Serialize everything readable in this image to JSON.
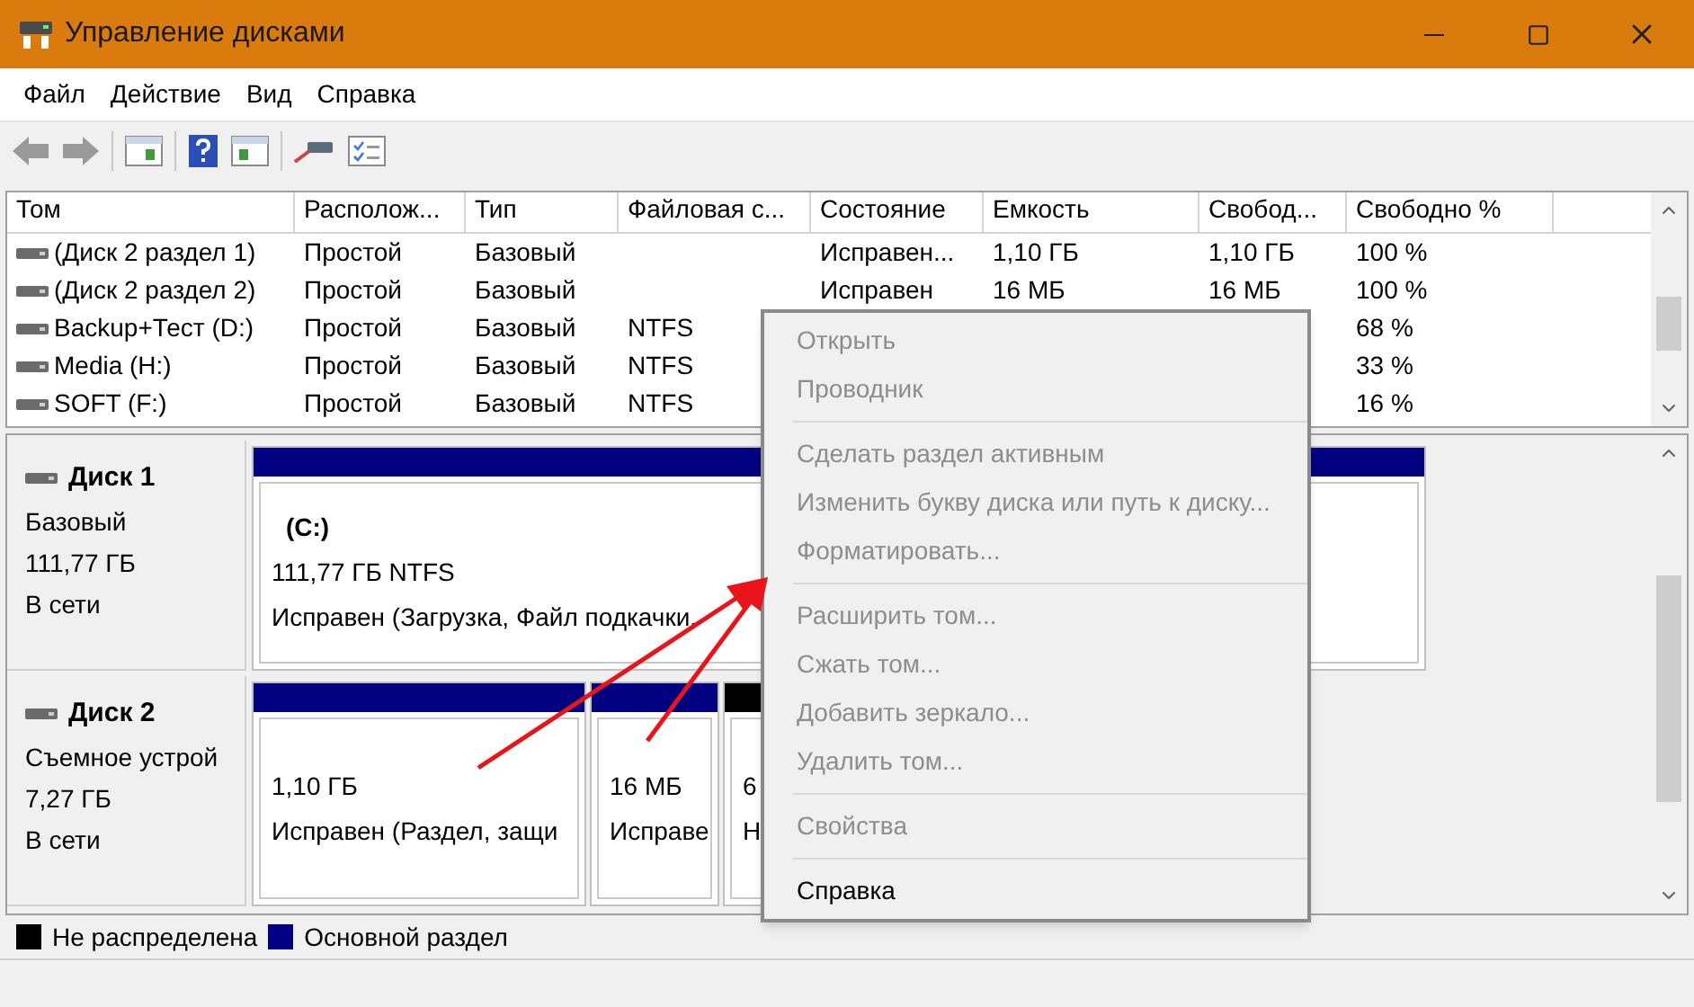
{
  "window": {
    "title": "Управление дисками"
  },
  "menu_bar": [
    "Файл",
    "Действие",
    "Вид",
    "Справка"
  ],
  "table": {
    "columns": [
      "Том",
      "Располож...",
      "Тип",
      "Файловая с...",
      "Состояние",
      "Емкость",
      "Свобод...",
      "Свободно %"
    ],
    "rows": [
      {
        "cells": [
          "(Диск 2 раздел 1)",
          "Простой",
          "Базовый",
          null,
          "Исправен...",
          "1,10 ГБ",
          "1,10 ГБ",
          "100 %"
        ]
      },
      {
        "cells": [
          "(Диск 2 раздел 2)",
          "Простой",
          "Базовый",
          null,
          "Исправен",
          "16 МБ",
          "16 МБ",
          "100 %"
        ]
      },
      {
        "cells": [
          "Backup+Тест (D:)",
          "Простой",
          "Базовый",
          "NTFS",
          null,
          null,
          null,
          "68 %"
        ]
      },
      {
        "cells": [
          "Media (H:)",
          "Простой",
          "Базовый",
          "NTFS",
          null,
          null,
          null,
          "33 %"
        ]
      },
      {
        "cells": [
          "SOFT (F:)",
          "Простой",
          "Базовый",
          "NTFS",
          null,
          null,
          null,
          "16 %"
        ]
      }
    ]
  },
  "disks": [
    {
      "name": "Диск 1",
      "type": "Базовый",
      "size": "111,77 ГБ",
      "status": "В сети",
      "partitions": [
        {
          "kind": "primary",
          "label": "(C:)",
          "size": "111,77 ГБ NTFS",
          "status": "Исправен (Загрузка, Файл подкачки,"
        }
      ]
    },
    {
      "name": "Диск 2",
      "type": "Съемное устрой",
      "size": "7,27 ГБ",
      "status": "В сети",
      "partitions": [
        {
          "kind": "primary",
          "size": "1,10 ГБ",
          "status": "Исправен (Раздел, защи"
        },
        {
          "kind": "primary",
          "size": "16 МБ",
          "status": "Исправе"
        },
        {
          "kind": "unallocated",
          "size": "6",
          "status": "Н"
        }
      ]
    }
  ],
  "legend": [
    {
      "label": "Не распределена",
      "color": "#000000"
    },
    {
      "label": "Основной раздел",
      "color": "#000080"
    }
  ],
  "context_menu": [
    {
      "kind": "item",
      "label": "Открыть",
      "disabled": true
    },
    {
      "kind": "item",
      "label": "Проводник",
      "disabled": true
    },
    {
      "kind": "separator"
    },
    {
      "kind": "item",
      "label": "Сделать раздел активным",
      "disabled": true
    },
    {
      "kind": "item",
      "label": "Изменить букву диска или путь к диску...",
      "disabled": true
    },
    {
      "kind": "item",
      "label": "Форматировать...",
      "disabled": true
    },
    {
      "kind": "separator"
    },
    {
      "kind": "item",
      "label": "Расширить том...",
      "disabled": true
    },
    {
      "kind": "item",
      "label": "Сжать том...",
      "disabled": true
    },
    {
      "kind": "item",
      "label": "Добавить зеркало...",
      "disabled": true
    },
    {
      "kind": "item",
      "label": "Удалить том...",
      "disabled": true
    },
    {
      "kind": "separator"
    },
    {
      "kind": "item",
      "label": "Свойства",
      "disabled": true
    },
    {
      "kind": "separator"
    },
    {
      "kind": "item",
      "label": "Справка",
      "disabled": false
    }
  ]
}
